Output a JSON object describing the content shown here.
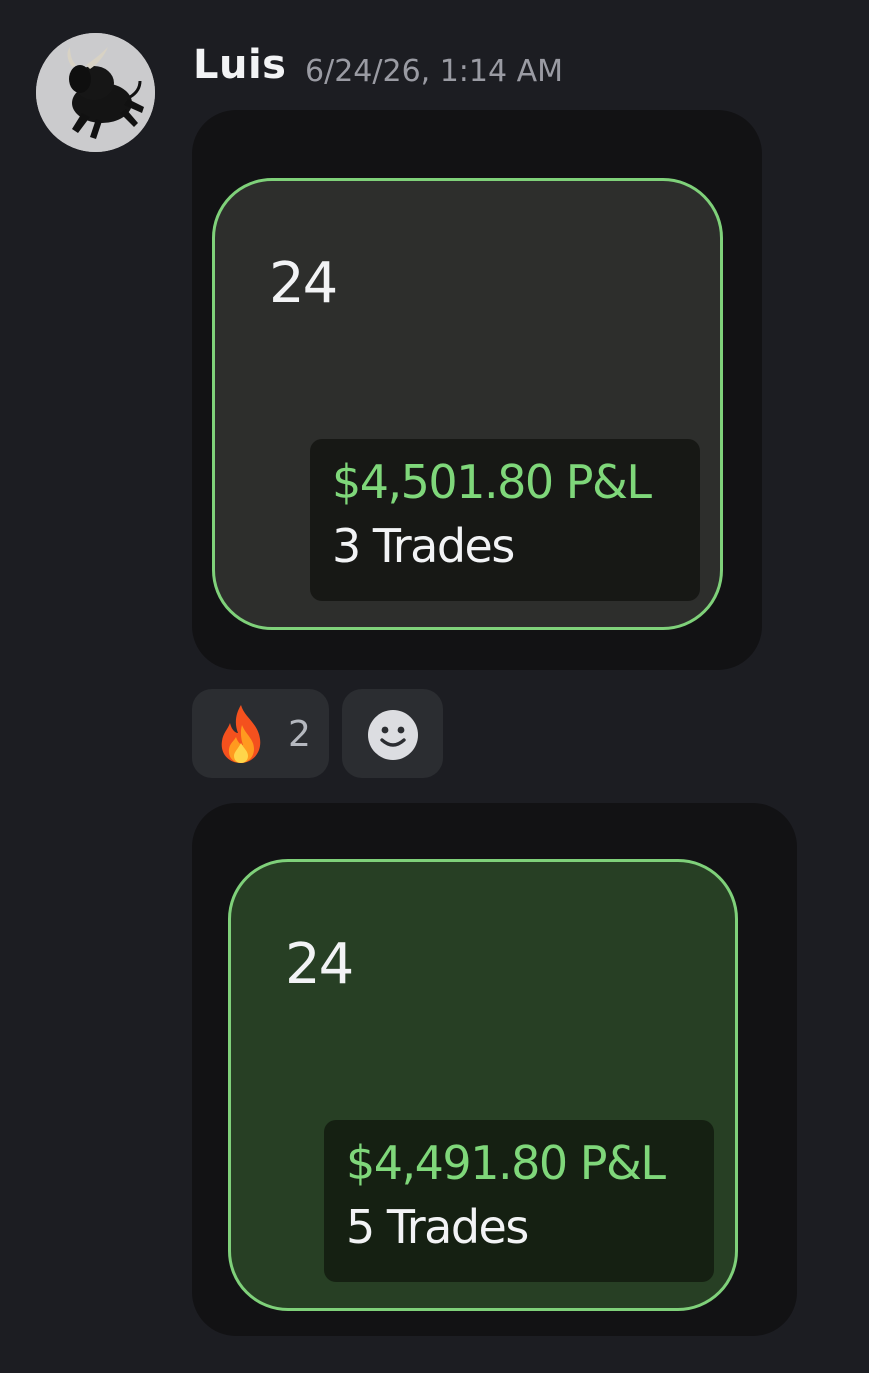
{
  "message": {
    "author": "Luis",
    "timestamp": "6/24/26, 1:14 AM",
    "avatar_icon": "bull-icon"
  },
  "attachments": [
    {
      "day": "24",
      "pnl": "$4,501.80 P&L",
      "trades": "3 Trades",
      "card_color": "#2d2e2c"
    },
    {
      "day": "24",
      "pnl": "$4,491.80 P&L",
      "trades": "5 Trades",
      "card_color": "#273f24"
    }
  ],
  "reactions": [
    {
      "emoji": "fire-icon",
      "count": "2"
    }
  ],
  "add_reaction_icon": "smile-icon",
  "colors": {
    "background": "#1c1d22",
    "attachment_bg": "#121214",
    "accent_green": "#7fd17a",
    "pnl_text": "#7fd77a"
  }
}
